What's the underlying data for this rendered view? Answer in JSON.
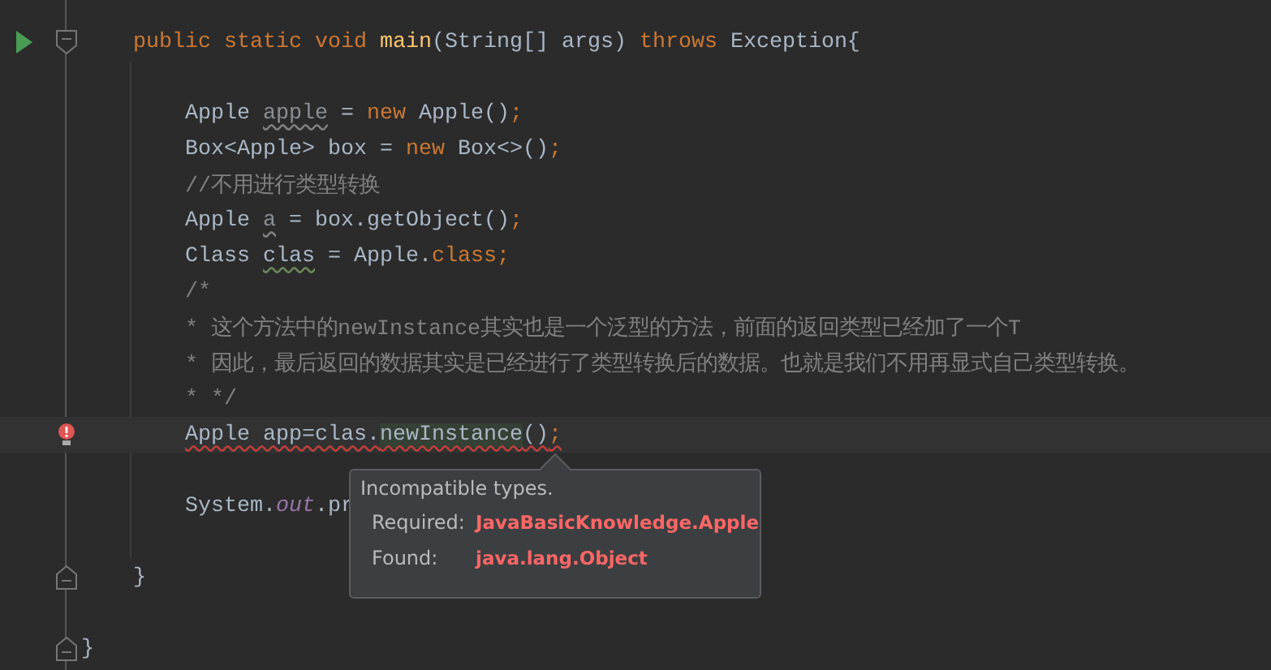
{
  "editor": {
    "lines": [
      {
        "markers": [
          {
            "kind": "run"
          },
          {
            "kind": "fold_start"
          }
        ],
        "current": false,
        "segments": [
          {
            "text": "    public static void ",
            "kind": "kw"
          },
          {
            "text": "main",
            "kind": "fn"
          },
          {
            "text": "(String[] args) ",
            "kind": "plain"
          },
          {
            "text": "throws ",
            "kind": "kw"
          },
          {
            "text": "Exception{",
            "kind": "plain"
          }
        ]
      },
      {
        "current": false
      },
      {
        "current": false,
        "segments": [
          {
            "text": "        Apple ",
            "kind": "plain"
          },
          {
            "text": "apple",
            "kind": "unused"
          },
          {
            "text": " = ",
            "kind": "plain"
          },
          {
            "text": "new ",
            "kind": "kw"
          },
          {
            "text": "Apple()",
            "kind": "plain"
          },
          {
            "text": ";",
            "kind": "kw"
          }
        ]
      },
      {
        "current": false,
        "segments": [
          {
            "text": "        Box<Apple> box = ",
            "kind": "plain"
          },
          {
            "text": "new ",
            "kind": "kw"
          },
          {
            "text": "Box<>()",
            "kind": "plain"
          },
          {
            "text": ";",
            "kind": "kw"
          }
        ]
      },
      {
        "current": false,
        "segments": [
          {
            "text": "        //不用进行类型转换",
            "kind": "comment"
          }
        ]
      },
      {
        "current": false,
        "segments": [
          {
            "text": "        Apple ",
            "kind": "plain"
          },
          {
            "text": "a",
            "kind": "unused"
          },
          {
            "text": " = box.getObject()",
            "kind": "plain"
          },
          {
            "text": ";",
            "kind": "kw"
          }
        ]
      },
      {
        "current": false,
        "segments": [
          {
            "text": "        Class ",
            "kind": "plain"
          },
          {
            "text": "clas",
            "kind": "warn"
          },
          {
            "text": " = Apple.",
            "kind": "plain"
          },
          {
            "text": "class;",
            "kind": "kw"
          }
        ]
      },
      {
        "current": false,
        "segments": [
          {
            "text": "        /*",
            "kind": "comment"
          }
        ]
      },
      {
        "current": false,
        "segments": [
          {
            "text": "        * 这个方法中的newInstance其实也是一个泛型的方法，前面的返回类型已经加了一个T",
            "kind": "comment"
          }
        ]
      },
      {
        "current": false,
        "segments": [
          {
            "text": "        * 因此，最后返回的数据其实是已经进行了类型转换后的数据。也就是我们不用再显式自己类型转换。",
            "kind": "comment"
          }
        ]
      },
      {
        "current": false,
        "segments": [
          {
            "text": "        * */",
            "kind": "comment"
          }
        ]
      },
      {
        "markers": [
          {
            "kind": "bulb"
          }
        ],
        "current": true,
        "segments": [
          {
            "text": "        Apple app=clas.",
            "kind": "error"
          },
          {
            "text": "newInstance",
            "kind": "error_hl"
          },
          {
            "text": "()",
            "kind": "error"
          },
          {
            "text": ";",
            "kind": "error_kw"
          }
        ]
      },
      {
        "current": false
      },
      {
        "current": false,
        "segments": [
          {
            "text": "        System.",
            "kind": "plain"
          },
          {
            "text": "out",
            "kind": "field"
          },
          {
            "text": ".pr",
            "kind": "plain"
          }
        ]
      },
      {
        "current": false
      },
      {
        "markers": [
          {
            "kind": "fold_end"
          }
        ],
        "current": false,
        "segments": [
          {
            "text": "    }",
            "kind": "plain"
          }
        ]
      },
      {
        "current": false
      },
      {
        "markers": [
          {
            "kind": "fold_end"
          }
        ],
        "current": false,
        "segments": [
          {
            "text": "}",
            "kind": "plain"
          }
        ]
      }
    ]
  },
  "tooltip": {
    "title": "Incompatible types.",
    "rows": [
      {
        "label": "Required:",
        "value": "JavaBasicKnowledge.Apple"
      },
      {
        "label": "Found:",
        "value": "java.lang.Object"
      }
    ]
  }
}
